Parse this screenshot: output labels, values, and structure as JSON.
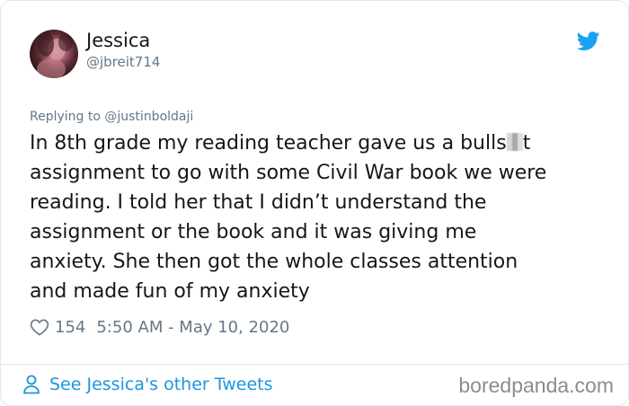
{
  "user": {
    "display_name": "Jessica",
    "handle": "@jbreit714"
  },
  "tweet": {
    "replying_to": "Replying to @justinboldaji",
    "lines": [
      "In 8th grade my reading teacher gave us a bulls",
      "t",
      "assignment to go with some Civil War book we were",
      "reading. I told her that I didn’t understand the",
      "assignment or the book and it was giving me",
      "anxiety. She then got the whole classes attention",
      "and made fun of my anxiety"
    ],
    "likes": "154",
    "timestamp": "5:50 AM - May 10, 2020"
  },
  "footer": {
    "see_more": "See Jessica's other Tweets",
    "watermark": "boredpanda.com"
  },
  "colors": {
    "accent": "#1b95e0",
    "twitter_blue": "#1da1f2",
    "secondary_text": "#657786",
    "border": "#e1e8ed"
  },
  "icons": {
    "brand": "twitter-bird-icon",
    "like": "heart-icon",
    "profile": "person-icon"
  }
}
